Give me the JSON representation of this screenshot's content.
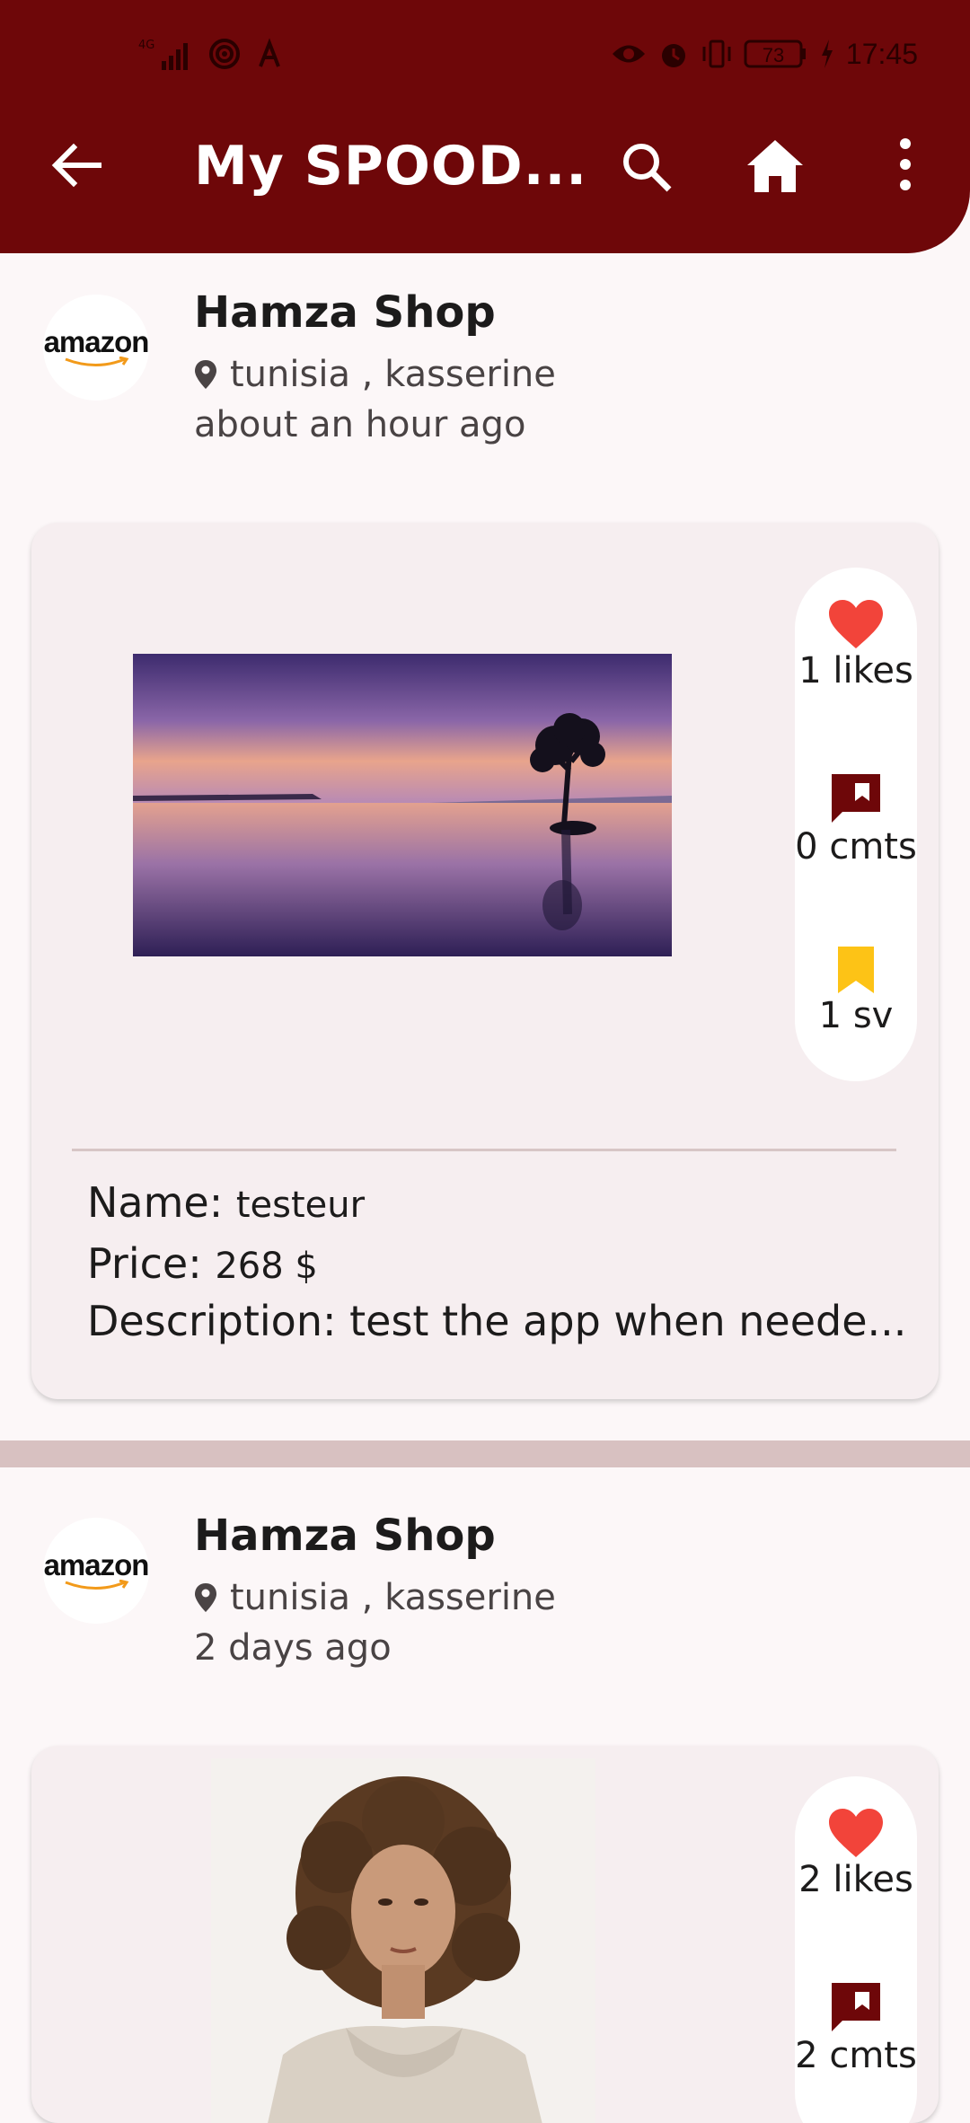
{
  "status_bar": {
    "network": "4G",
    "battery": "73",
    "time": "17:45"
  },
  "toolbar": {
    "title": "My SPOOD...",
    "icons": [
      "back-arrow-icon",
      "search-icon",
      "home-icon",
      "more-vert-icon"
    ]
  },
  "posts": [
    {
      "shop_logo_text": "amazon",
      "shop_name": "Hamza Shop",
      "location": "tunisia , kasserine",
      "time_ago": "about an hour ago",
      "likes": "1 likes",
      "comments": "0 cmts",
      "saves": "1 sv",
      "name_label": "Name:",
      "name_value": "testeur",
      "price_label": "Price:",
      "price_value": "268 $",
      "description_label": "Description:",
      "description_value": "test the app when neede..."
    },
    {
      "shop_logo_text": "amazon",
      "shop_name": "Hamza Shop",
      "location": "tunisia , kasserine",
      "time_ago": "2 days ago",
      "likes": "2 likes",
      "comments": "2 cmts"
    }
  ],
  "colors": {
    "appbar": "#6e0709",
    "heart": "#f2443a",
    "comment": "#6e0709",
    "bookmark": "#fdc316",
    "card_bg": "#f6eef0"
  }
}
